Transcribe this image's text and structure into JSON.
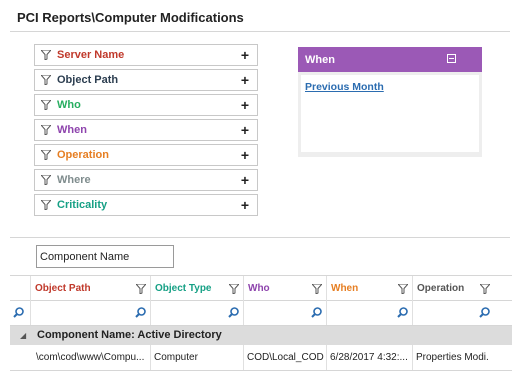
{
  "title": "PCI Reports\\Computer Modifications",
  "filters": [
    {
      "label": "Server Name",
      "color": "#c0392b"
    },
    {
      "label": "Object Path",
      "color": "#2c3e50"
    },
    {
      "label": "Who",
      "color": "#27ae60"
    },
    {
      "label": "When",
      "color": "#8e44ad"
    },
    {
      "label": "Operation",
      "color": "#e67e22"
    },
    {
      "label": "Where",
      "color": "#7f8c8d"
    },
    {
      "label": "Criticality",
      "color": "#16a085"
    }
  ],
  "when_panel": {
    "header": "When",
    "link": "Previous Month",
    "header_color": "#9b59b6"
  },
  "group_by_input": {
    "value": "Component Name"
  },
  "grid": {
    "columns": [
      {
        "label": "Object Path",
        "color": "#c0392b"
      },
      {
        "label": "Object Type",
        "color": "#16a085"
      },
      {
        "label": "Who",
        "color": "#8e44ad"
      },
      {
        "label": "When",
        "color": "#e67e22"
      },
      {
        "label": "Operation",
        "color": "#555555"
      }
    ],
    "group_label": "Component Name: Active Directory",
    "rows": [
      {
        "cells": [
          "\\com\\cod\\www\\Compu...",
          "Computer",
          "COD\\Local_COD",
          "6/28/2017 4:32:...",
          "Properties Modi."
        ]
      }
    ]
  }
}
